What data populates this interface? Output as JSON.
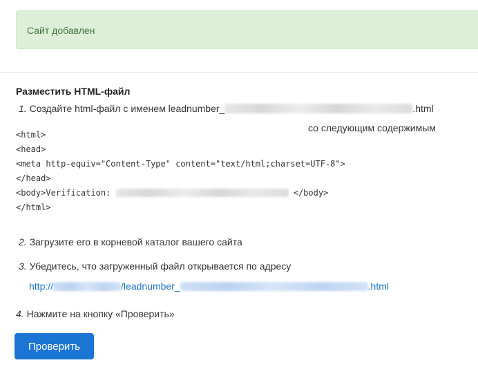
{
  "alert": {
    "text": "Сайт добавлен"
  },
  "section": {
    "title": "Разместить HTML-файл",
    "step1": {
      "num": "1.",
      "text": "Создайте html-файл с именем leadnumber_",
      "ext": ".html",
      "continuation": "со следующим содержимым"
    },
    "code": {
      "line1": "<html>",
      "line2": "<head>",
      "line3": "<meta http-equiv=\"Content-Type\" content=\"text/html;charset=UTF-8\">",
      "line4": "</head>",
      "line5_start": "<body>Verification: ",
      "line5_end": " </body>",
      "line6": "</html>"
    },
    "step2": {
      "num": "2.",
      "text": "Загрузите его в корневой каталог вашего сайта"
    },
    "step3": {
      "num": "3.",
      "text": "Убедитесь, что загруженный файл открывается по адресу"
    },
    "link": {
      "scheme": "http://",
      "path": "/leadnumber_",
      "ext": ".html"
    },
    "step4": {
      "num": "4.",
      "text": "Нажмите на кнопку «Проверить»"
    },
    "button": {
      "label": "Проверить"
    }
  }
}
